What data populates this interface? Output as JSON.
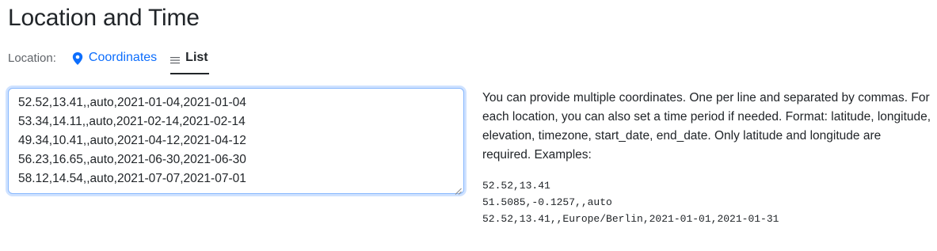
{
  "page": {
    "title": "Location and Time"
  },
  "location_tabs": {
    "label": "Location:",
    "items": [
      {
        "label": "Coordinates",
        "icon": "map-pin-icon",
        "active": false
      },
      {
        "label": "List",
        "icon": "list-icon",
        "active": true
      }
    ]
  },
  "coordinates_list": {
    "value": "52.52,13.41,,auto,2021-01-04,2021-01-04\n53.34,14.11,,auto,2021-02-14,2021-02-14\n49.34,10.41,,auto,2021-04-12,2021-04-12\n56.23,16.65,,auto,2021-06-30,2021-06-30\n58.12,14.54,,auto,2021-07-07,2021-07-01"
  },
  "help": {
    "text": "You can provide multiple coordinates. One per line and separated by commas. For each location, you can also set a time period if needed. Format: latitude, longitude, elevation, timezone, start_date, end_date. Only latitude and longitude are required. Examples:",
    "examples": [
      "52.52,13.41",
      "51.5085,-0.1257,,auto",
      "52.52,13.41,,Europe/Berlin,2021-01-01,2021-01-31"
    ]
  },
  "colors": {
    "accent": "#0d6efd",
    "text": "#212529",
    "muted": "#5f6368",
    "focus_border": "#86b7fe"
  }
}
